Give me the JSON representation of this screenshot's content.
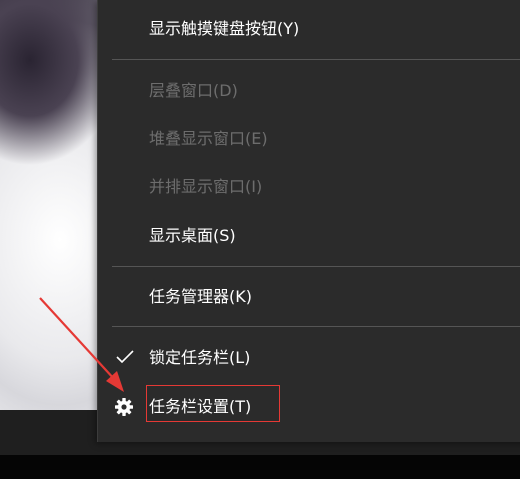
{
  "context_menu": {
    "items": [
      {
        "label": "显示触摸键盘按钮(Y)",
        "enabled": true
      },
      {
        "label": "层叠窗口(D)",
        "enabled": false
      },
      {
        "label": "堆叠显示窗口(E)",
        "enabled": false
      },
      {
        "label": "并排显示窗口(I)",
        "enabled": false
      },
      {
        "label": "显示桌面(S)",
        "enabled": true
      },
      {
        "label": "任务管理器(K)",
        "enabled": true
      },
      {
        "label": "锁定任务栏(L)",
        "enabled": true,
        "checked": true,
        "icon": "checkmark-icon"
      },
      {
        "label": "任务栏设置(T)",
        "enabled": true,
        "icon": "gear-icon",
        "highlighted": true
      }
    ]
  },
  "colors": {
    "menu_background": "#2b2b2b",
    "text_enabled": "#ffffff",
    "text_disabled": "#6d6d6d",
    "separator": "#555555",
    "annotation_red": "#e53935"
  }
}
